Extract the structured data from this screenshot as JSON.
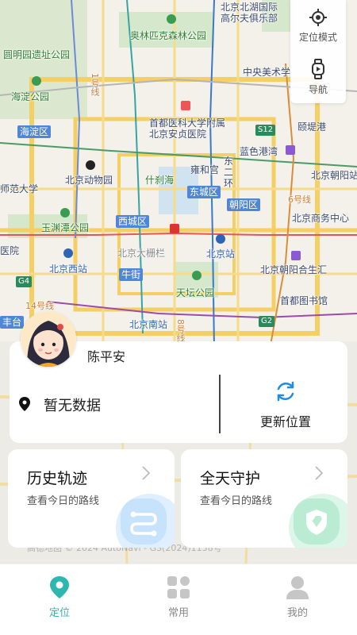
{
  "map": {
    "districts": [
      "海淀区",
      "东城区",
      "朝阳区",
      "西城区"
    ],
    "labels": {
      "yuanmingyuan": "圆明园遗址公园",
      "haidian_park": "海淀公园",
      "olympic": "奥林匹克森林公园",
      "beijing_north_lake": "北京北湖国际",
      "gaoerfu": "高尔夫俱乐部",
      "cafa": "中央美术学",
      "pumc": "首都医科大学附属北京安贞医院",
      "yiheyuan": "颐堤港",
      "blue_harbor": "蓝色港湾",
      "zoo": "北京动物园",
      "shichahai": "什刹海",
      "yonghegong": "雍和宫",
      "dongerhuan": "东二环",
      "normal_univ": "师范大学",
      "yuyuantan": "玉渊潭公园",
      "beijing_cbd": "北京商务中心",
      "beijing_chaoyang_station": "北京朝阳站",
      "hospital": "医院",
      "dashilan": "北京大栅栏",
      "beijing_station": "北京站",
      "west_station": "北京西站",
      "niujie": "牛街",
      "temple_heaven": "天坛公园",
      "chaoyang_hesheng": "北京朝阳合生汇",
      "capital_library": "首都图书馆",
      "fengtai": "丰台",
      "south_station": "北京南站",
      "line6": "6号线",
      "line14": "14号线",
      "line8": "8号线",
      "line1": "1号线"
    },
    "road_badges": [
      "S12",
      "G4",
      "G2"
    ],
    "copyright": "高德地图 © 2024 AutoNavi - GS(2024)1158号"
  },
  "tools": {
    "locate_mode": "定位模式",
    "navigate": "导航"
  },
  "location_card": {
    "user_name": "陈平安",
    "address": "暂无数据",
    "update_label": "更新位置"
  },
  "features": {
    "history": {
      "title": "历史轨迹",
      "subtitle": "查看今日的路线"
    },
    "guard": {
      "title": "全天守护",
      "subtitle": "查看今日的路线"
    }
  },
  "tabs": [
    {
      "label": "定位",
      "active": true
    },
    {
      "label": "常用",
      "active": false
    },
    {
      "label": "我的",
      "active": false
    }
  ],
  "colors": {
    "accent": "#2cb7b0",
    "update_icon": "#1f8de0"
  }
}
